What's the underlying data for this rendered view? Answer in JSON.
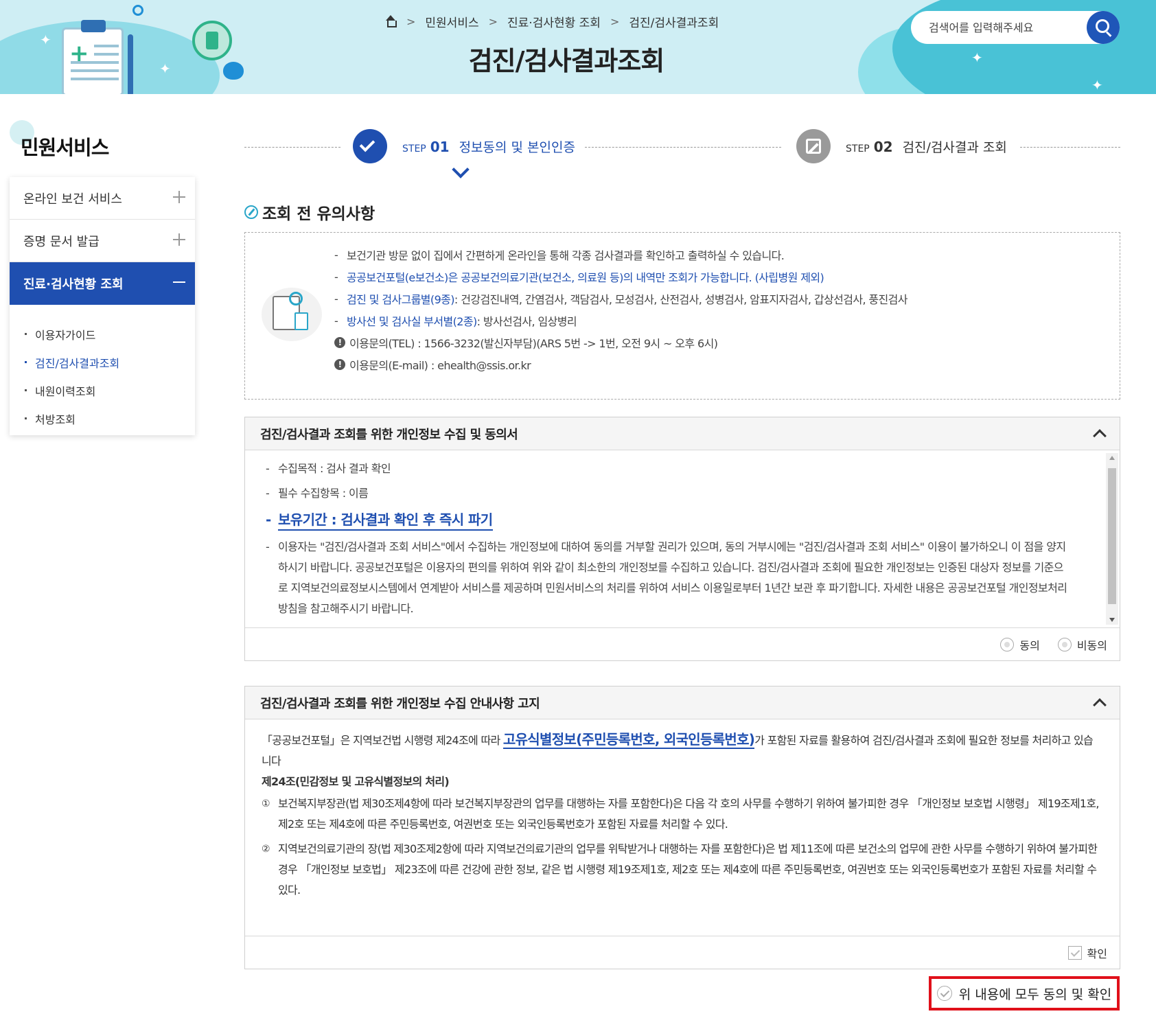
{
  "header": {
    "breadcrumb": [
      "민원서비스",
      "진료·검사현황 조회",
      "검진/검사결과조회"
    ],
    "title": "검진/검사결과조회",
    "search_placeholder": "검색어를 입력해주세요"
  },
  "sidebar": {
    "title": "민원서비스",
    "items": [
      {
        "label": "온라인 보건 서비스"
      },
      {
        "label": "증명 문서 발급"
      },
      {
        "label": "진료·검사현황 조회"
      }
    ],
    "subitems": [
      {
        "label": "이용자가이드"
      },
      {
        "label": "검진/검사결과조회"
      },
      {
        "label": "내원이력조회"
      },
      {
        "label": "처방조회"
      }
    ]
  },
  "steps": [
    {
      "prefix": "STEP",
      "num": "01",
      "label": "정보동의 및 본인인증"
    },
    {
      "prefix": "STEP",
      "num": "02",
      "label": "검진/검사결과 조회"
    }
  ],
  "notice": {
    "title": "조회 전 유의사항",
    "lines": [
      "보건기관 방문 없이 집에서 간편하게 온라인을 통해 각종 검사결과를 확인하고 출력하실 수 있습니다.",
      "공공보건포털(e보건소)은 공공보건의료기관(보건소, 의료원 등)의 내역만 조회가 가능합니다. (사립병원 제외)"
    ],
    "line3_hl": "검진 및 검사그룹별(9종)",
    "line3_rest": " : 건강검진내역, 간염검사, 객담검사, 모성검사, 산전검사, 성병검사, 암표지자검사, 갑상선검사, 풍진검사",
    "line4_hl": "방사선 및 검사실 부서별(2종)",
    "line4_rest": " : 방사선검사, 임상병리",
    "tel": "이용문의(TEL) : 1566-3232(발신자부담)(ARS 5번 -> 1번, 오전 9시 ~ 오후 6시)",
    "email": "이용문의(E-mail) : ehealth@ssis.or.kr"
  },
  "panel1": {
    "title": "검진/검사결과 조회를 위한 개인정보 수집 및 동의서",
    "purpose": "수집목적 : 검사 결과 확인",
    "items": "필수 수집항목 : 이름",
    "retention": "보유기간 : 검사결과 확인 후 즉시 파기",
    "para": "이용자는 \"검진/검사결과 조회 서비스\"에서 수집하는 개인정보에 대하여 동의를 거부할 권리가 있으며, 동의 거부시에는 \"검진/검사결과 조회 서비스\" 이용이 불가하오니 이 점을 양지하시기 바랍니다. 공공보건포털은 이용자의 편의를 위하여 위와 같이 최소한의 개인정보를 수집하고 있습니다. 검진/검사결과 조회에 필요한 개인정보는 인증된 대상자 정보를 기준으로 지역보건의료정보시스템에서 연계받아 서비스를 제공하며 민원서비스의 처리를 위하여 서비스 이용일로부터 1년간 보관 후 파기합니다. 자세한 내용은 공공보건포털 개인정보처리방침을 참고해주시기 바랍니다.",
    "agree": "동의",
    "disagree": "비동의"
  },
  "panel2": {
    "title": "검진/검사결과 조회를 위한 개인정보 수집 안내사항 고지",
    "intro_a": "「공공보건포털」은 지역보건법 시행령 제24조에 따라 ",
    "intro_hl": "고유식별정보(주민등록번호, 외국인등록번호)",
    "intro_b": "가 포함된 자료를 활용하여 검진/검사결과 조회에 필요한 정보를 처리하고 있습니다",
    "article": "제24조(민감정보 및 고유식별정보의 처리)",
    "n1": "①",
    "item1": "보건복지부장관(법 제30조제4항에 따라 보건복지부장관의 업무를 대행하는 자를 포함한다)은 다음 각 호의 사무를 수행하기 위하여 불가피한 경우 「개인정보 보호법 시행령」 제19조제1호, 제2호 또는 제4호에 따른 주민등록번호, 여권번호 또는 외국인등록번호가 포함된 자료를 처리할 수 있다.",
    "n2": "②",
    "item2": "지역보건의료기관의 장(법 제30조제2항에 따라 지역보건의료기관의 업무를 위탁받거나 대행하는 자를 포함한다)은 법 제11조에 따른 보건소의 업무에 관한 사무를 수행하기 위하여 불가피한 경우 「개인정보 보호법」 제23조에 따른 건강에 관한 정보, 같은 법 시행령 제19조제1호, 제2호 또는 제4호에 따른 주민등록번호, 여권번호 또는 외국인등록번호가 포함된 자료를 처리할 수 있다.",
    "confirm": "확인"
  },
  "agree_all": "위 내용에 모두 동의 및 확인"
}
